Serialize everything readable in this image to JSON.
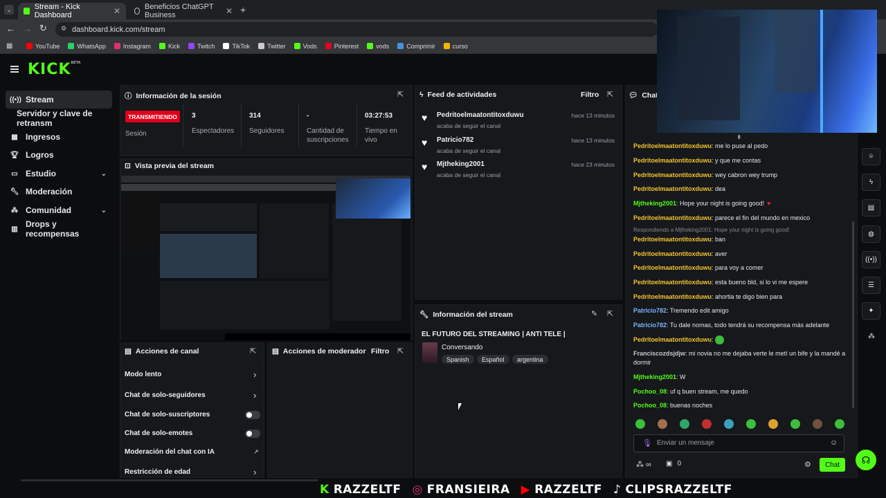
{
  "browser": {
    "tabs": [
      {
        "title": "Stream - Kick Dashboard",
        "active": true
      },
      {
        "title": "Beneficios ChatGPT Business",
        "active": false
      }
    ],
    "url": "dashboard.kick.com/stream"
  },
  "bookmarks": [
    {
      "label": "YouTube",
      "color": "#ff0000"
    },
    {
      "label": "WhatsApp",
      "color": "#25d366"
    },
    {
      "label": "Instagram",
      "color": "#e1306c"
    },
    {
      "label": "Kick",
      "color": "#53fc18"
    },
    {
      "label": "Twitch",
      "color": "#9146ff"
    },
    {
      "label": "TikTok",
      "color": "#ffffff"
    },
    {
      "label": "Twitter",
      "color": "#cccccc"
    },
    {
      "label": "Vods",
      "color": "#53fc18"
    },
    {
      "label": "Pinterest",
      "color": "#e60023"
    },
    {
      "label": "vods",
      "color": "#53fc18"
    },
    {
      "label": "Comprimir",
      "color": "#4a90e2"
    },
    {
      "label": "curso",
      "color": "#f4b400"
    }
  ],
  "app": {
    "logo": "KICK",
    "logo_sup": "BETA",
    "accent": "#53fc18"
  },
  "sidebar": [
    {
      "label": "Stream",
      "icon": "broadcast-icon",
      "active": true
    },
    {
      "label": "Servidor y clave de retransm",
      "icon": "",
      "active": false
    },
    {
      "label": "Ingresos",
      "icon": "money-icon",
      "active": false
    },
    {
      "label": "Logros",
      "icon": "trophy-icon",
      "active": false
    },
    {
      "label": "Estudio",
      "icon": "studio-icon",
      "active": false,
      "chevron": true
    },
    {
      "label": "Moderación",
      "icon": "wrench-icon",
      "active": false
    },
    {
      "label": "Comunidad",
      "icon": "community-icon",
      "active": false,
      "chevron": true
    },
    {
      "label": "Drops y recompensas",
      "icon": "gift-icon",
      "active": false
    }
  ],
  "session": {
    "title": "Información de la sesión",
    "live_badge": "TRANSMITIENDO",
    "session_label": "Sesión",
    "stats": [
      {
        "value": "3",
        "label": "Espectadores"
      },
      {
        "value": "314",
        "label": "Seguidores"
      },
      {
        "value": "-",
        "label": "Cantidad de suscripciones"
      },
      {
        "value": "03:27:53",
        "label": "Tiempo en vivo"
      }
    ]
  },
  "preview": {
    "title": "Vista previa del stream"
  },
  "feed": {
    "title": "Feed de actividades",
    "filter": "Filtro",
    "items": [
      {
        "name": "Pedritoelmaatontitoxduwu",
        "sub": "acaba de seguir el canal",
        "time": "hace 13 minutos"
      },
      {
        "name": "Patricio782",
        "sub": "acaba de seguir el canal",
        "time": "hace 13 minutos"
      },
      {
        "name": "Mjtheking2001",
        "sub": "acaba de seguir el canal",
        "time": "hace 23 minutos"
      }
    ]
  },
  "stream_info": {
    "title": "Información del stream",
    "stream_title": "EL FUTURO DEL STREAMING | ANTI TELE |",
    "category": "Conversando",
    "tags": [
      "Spanish",
      "Español",
      "argentina"
    ]
  },
  "channel_actions": {
    "title": "Acciones de canal",
    "items": [
      {
        "label": "Modo lento",
        "control": "chevron"
      },
      {
        "label": "Chat de solo-seguidores",
        "control": "chevron"
      },
      {
        "label": "Chat de solo-suscriptores",
        "control": "toggle"
      },
      {
        "label": "Chat de solo-emotes",
        "control": "toggle"
      },
      {
        "label": "Moderación del chat con IA",
        "control": "external"
      },
      {
        "label": "Restricción de edad",
        "control": "chevron"
      }
    ]
  },
  "mod_actions": {
    "title": "Acciones de moderador",
    "filter": "Filtro"
  },
  "chat": {
    "title": "Chat",
    "reply_text": "Respondiendo a Mjtheking2001: Hope your night is going good!",
    "messages": [
      {
        "user": "Pedritoelmaatontitoxduwu",
        "color": "#f4c430",
        "text": "me lo puse al pedo"
      },
      {
        "user": "Pedritoelmaatontitoxduwu",
        "color": "#f4c430",
        "text": "y que me contas"
      },
      {
        "user": "Pedritoelmaatontitoxduwu",
        "color": "#f4c430",
        "text": "wey cabron wey trump"
      },
      {
        "user": "Pedritoelmaatontitoxduwu",
        "color": "#f4c430",
        "text": "dea"
      },
      {
        "user": "Mjtheking2001",
        "color": "#53fc18",
        "text": "Hope your night is going good!"
      },
      {
        "user": "Pedritoelmaatontitoxduwu",
        "color": "#f4c430",
        "text": "parece el fin del mundo en mexico"
      },
      {
        "user": "Pedritoelmaatontitoxduwu",
        "color": "#f4c430",
        "text": "ban"
      },
      {
        "user": "Pedritoelmaatontitoxduwu",
        "color": "#f4c430",
        "text": "aver"
      },
      {
        "user": "Pedritoelmaatontitoxduwu",
        "color": "#f4c430",
        "text": "para voy a comer"
      },
      {
        "user": "Pedritoelmaatontitoxduwu",
        "color": "#f4c430",
        "text": "esta bueno bld, si lo vi me espere"
      },
      {
        "user": "Pedritoelmaatontitoxduwu",
        "color": "#f4c430",
        "text": "ahortia te digo bien para"
      },
      {
        "user": "Patricio782",
        "color": "#7fb3ff",
        "text": "Tremendo edit amigo"
      },
      {
        "user": "Patricio782",
        "color": "#7fb3ff",
        "text": "Tu dale nomas, todo tendrá su recompensa más adelante"
      },
      {
        "user": "Pedritoelmaatontitoxduwu",
        "color": "#f4c430",
        "text": ""
      },
      {
        "user": "Franciscozdsjdjw",
        "color": "#c8c8c8",
        "text": "mi novia no me dejaba verte le metí un bife y la mandé a dormir"
      },
      {
        "user": "Mjtheking2001",
        "color": "#53fc18",
        "text": "W"
      },
      {
        "user": "Pochoo_08",
        "color": "#53fc18",
        "text": "uf q buen stream, me quedo"
      },
      {
        "user": "Pochoo_08",
        "color": "#53fc18",
        "text": "buenas noches"
      }
    ],
    "input_placeholder": "Enviar un mensaje",
    "points": "∞",
    "gifts": "0",
    "send_label": "Chat"
  },
  "ticker": [
    {
      "icon": "K",
      "icon_color": "#53fc18",
      "text": "RAZZELTF"
    },
    {
      "icon": "◎",
      "icon_color": "#e1306c",
      "text": "FRANSIEIRA"
    },
    {
      "icon": "▶",
      "icon_color": "#ff0000",
      "text": "RAZZELTF"
    },
    {
      "icon": "♪",
      "icon_color": "#ffffff",
      "text": "CLIPSRAZZELTF"
    }
  ]
}
